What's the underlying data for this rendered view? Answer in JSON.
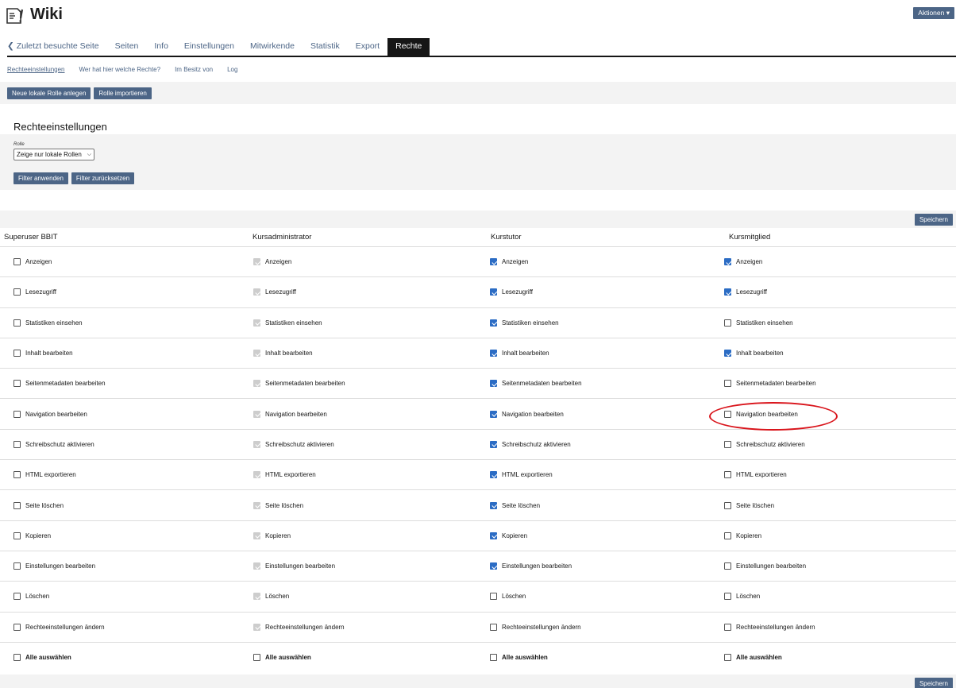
{
  "app": {
    "title": "Wiki",
    "icon": "wiki-page-icon",
    "actions_label": "Aktionen ▾"
  },
  "tabs": [
    {
      "label": "❮ Zuletzt besuchte Seite",
      "active": false
    },
    {
      "label": "Seiten",
      "active": false
    },
    {
      "label": "Info",
      "active": false
    },
    {
      "label": "Einstellungen",
      "active": false
    },
    {
      "label": "Mitwirkende",
      "active": false
    },
    {
      "label": "Statistik",
      "active": false
    },
    {
      "label": "Export",
      "active": false
    },
    {
      "label": "Rechte",
      "active": true
    }
  ],
  "subtabs": [
    {
      "label": "Rechteeinstellungen",
      "active": true
    },
    {
      "label": "Wer hat hier welche Rechte?",
      "active": false
    },
    {
      "label": "Im Besitz von",
      "active": false
    },
    {
      "label": "Log",
      "active": false
    }
  ],
  "toolbar": {
    "new_role": "Neue lokale Rolle anlegen",
    "import_role": "Rolle importieren"
  },
  "section_title": "Rechteeinstellungen",
  "filter": {
    "label": "Rolle",
    "selected": "Zeige nur lokale Rollen",
    "apply": "Filter anwenden",
    "reset": "Filter zurücksetzen"
  },
  "save_label": "Speichern",
  "columns": [
    "Superuser BBIT",
    "Kursadministrator",
    "Kurstutor",
    "Kursmitglied"
  ],
  "permissions": [
    {
      "label": "Anzeigen",
      "states": [
        "unchecked",
        "disabled",
        "checked",
        "checked"
      ]
    },
    {
      "label": "Lesezugriff",
      "states": [
        "unchecked",
        "disabled",
        "checked",
        "checked"
      ]
    },
    {
      "label": "Statistiken einsehen",
      "states": [
        "unchecked",
        "disabled",
        "checked",
        "unchecked"
      ]
    },
    {
      "label": "Inhalt bearbeiten",
      "states": [
        "unchecked",
        "disabled",
        "checked",
        "checked"
      ]
    },
    {
      "label": "Seitenmetadaten bearbeiten",
      "states": [
        "unchecked",
        "disabled",
        "checked",
        "unchecked"
      ]
    },
    {
      "label": "Navigation bearbeiten",
      "states": [
        "unchecked",
        "disabled",
        "checked",
        "unchecked"
      ]
    },
    {
      "label": "Schreibschutz aktivieren",
      "states": [
        "unchecked",
        "disabled",
        "checked",
        "unchecked"
      ]
    },
    {
      "label": "HTML exportieren",
      "states": [
        "unchecked",
        "disabled",
        "checked",
        "unchecked"
      ]
    },
    {
      "label": "Seite löschen",
      "states": [
        "unchecked",
        "disabled",
        "checked",
        "unchecked"
      ]
    },
    {
      "label": "Kopieren",
      "states": [
        "unchecked",
        "disabled",
        "checked",
        "unchecked"
      ]
    },
    {
      "label": "Einstellungen bearbeiten",
      "states": [
        "unchecked",
        "disabled",
        "checked",
        "unchecked"
      ]
    },
    {
      "label": "Löschen",
      "states": [
        "unchecked",
        "disabled",
        "unchecked",
        "unchecked"
      ]
    },
    {
      "label": "Rechteeinstellungen ändern",
      "states": [
        "unchecked",
        "disabled",
        "unchecked",
        "unchecked"
      ]
    }
  ],
  "select_all_label": "Alle auswählen",
  "colors": {
    "primary_button": "#4c6586",
    "checkbox_checked": "#2b6cc4",
    "checkbox_disabled": "#cdcdcd",
    "highlight_ellipse": "#d9141b"
  }
}
